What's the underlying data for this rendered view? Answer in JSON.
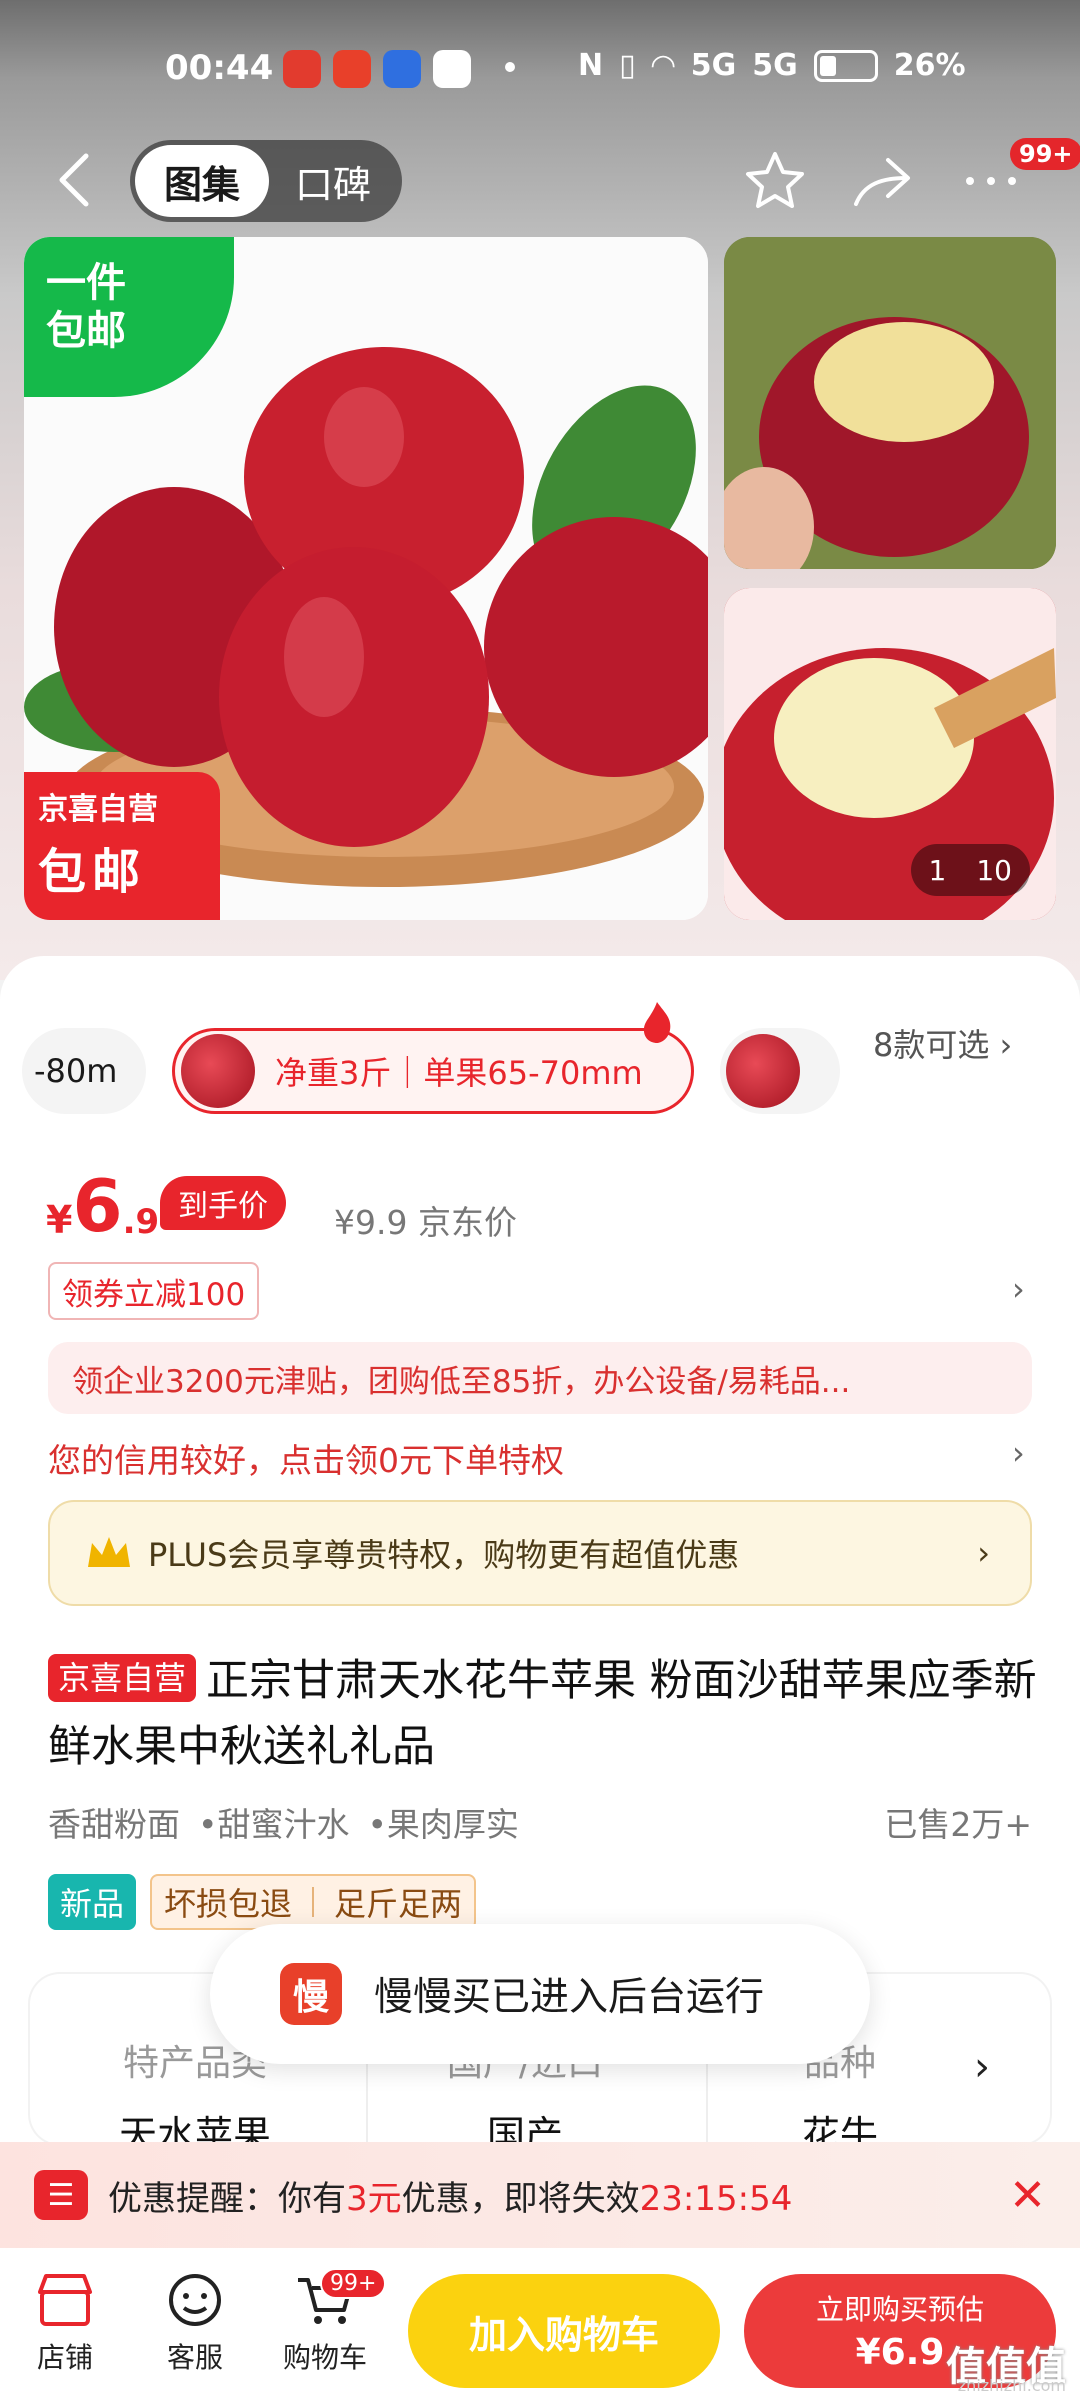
{
  "status_bar": {
    "time": "00:44",
    "battery": "26%",
    "signal1": "5G",
    "signal2": "5G"
  },
  "nav": {
    "tab_gallery": "图集",
    "tab_reviews": "口碑",
    "badge": "99+"
  },
  "gallery": {
    "tag_green": "一件\n包邮",
    "tag_red_line1": "京喜自营",
    "tag_red_line2": "包邮",
    "counter_current": "1",
    "counter_total": "10"
  },
  "variants": {
    "left_partial": "-80m",
    "selected": "净重3斤｜单果65-70mm",
    "more": "8款可选"
  },
  "price": {
    "currency": "¥",
    "integer": "6",
    "decimal": ".9",
    "final_label": "到手价",
    "jd_price": "¥9.9 京东价"
  },
  "promo": {
    "coupon": "领券立减100",
    "enterprise": "领企业3200元津贴，团购低至85折，办公设备/易耗品...",
    "credit": "您的信用较好，点击领0元下单特权",
    "plus": "PLUS会员享尊贵特权，购物更有超值优惠"
  },
  "product": {
    "store_tag": "京喜自营",
    "title": "正宗甘肃天水花牛苹果 粉面沙甜苹果应季新鲜水果中秋送礼礼品",
    "features": [
      "香甜粉面",
      "•甜蜜汁水",
      "•果肉厚实"
    ],
    "sold": "已售2万+",
    "tag_new": "新品",
    "tag_return": "坏损包退",
    "tag_weight": "足斤足两"
  },
  "spec": {
    "col1_key": "特产品类",
    "col1_val": "天水苹果",
    "col2_key": "国产/进口",
    "col2_val": "国产",
    "col3_key": "品种",
    "col3_val": "花牛"
  },
  "toast": {
    "logo": "慢",
    "message": "慢慢买已进入后台运行"
  },
  "reminder": {
    "prefix": "优惠提醒：你有",
    "amount": "3元",
    "suffix": "优惠，即将失效",
    "countdown": "23:15:54"
  },
  "bottom": {
    "store": "店铺",
    "service": "客服",
    "cart": "购物车",
    "cart_badge": "99+",
    "add_cart": "加入购物车",
    "buy_now": "立即购买预估",
    "buy_price": "¥6.9"
  },
  "watermark": {
    "main": "值值值",
    "sub": "zhizhizhi.com"
  }
}
